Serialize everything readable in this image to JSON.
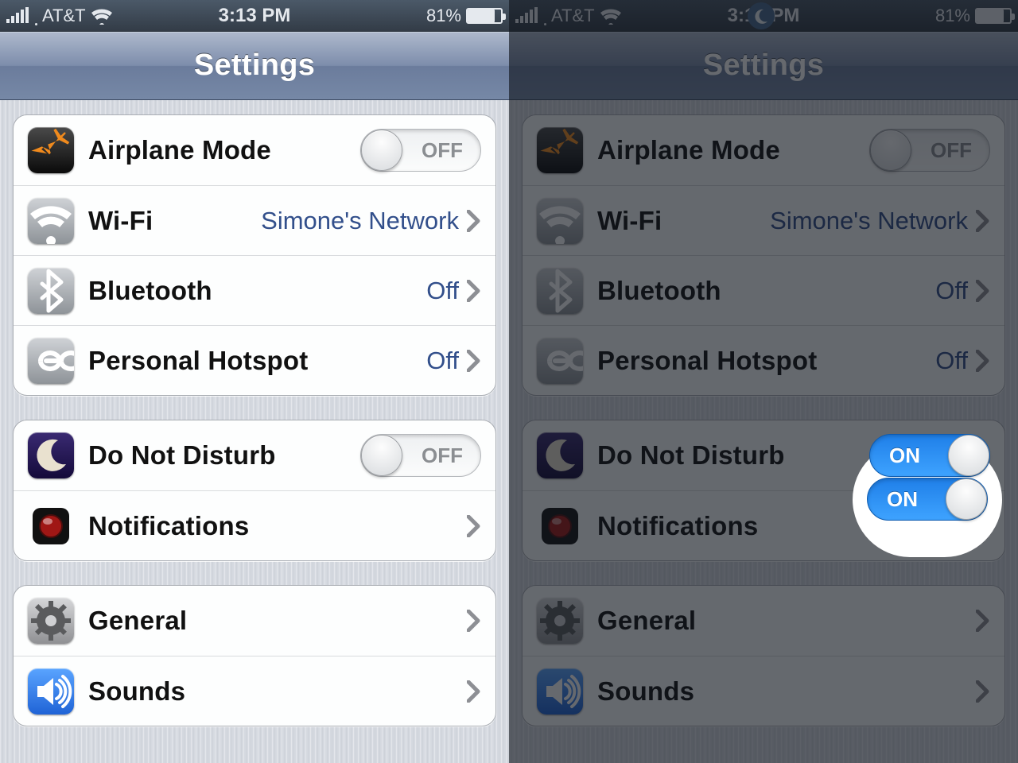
{
  "status": {
    "carrier": "AT&T",
    "time": "3:13 PM",
    "battery_pct": "81%",
    "battery_fill": 81
  },
  "nav": {
    "title": "Settings"
  },
  "toggle_labels": {
    "on": "ON",
    "off": "OFF"
  },
  "group1": {
    "airplane": {
      "label": "Airplane Mode"
    },
    "wifi": {
      "label": "Wi-Fi",
      "value": "Simone's Network"
    },
    "bluetooth": {
      "label": "Bluetooth",
      "value": "Off"
    },
    "hotspot": {
      "label": "Personal Hotspot",
      "value": "Off"
    }
  },
  "group2": {
    "dnd": {
      "label": "Do Not Disturb"
    },
    "notifications": {
      "label": "Notifications"
    }
  },
  "group3": {
    "general": {
      "label": "General"
    },
    "sounds": {
      "label": "Sounds"
    }
  },
  "left": {
    "dnd_on": false,
    "show_moon": false,
    "dimmed": false
  },
  "right": {
    "dnd_on": true,
    "show_moon": true,
    "dimmed": true
  }
}
